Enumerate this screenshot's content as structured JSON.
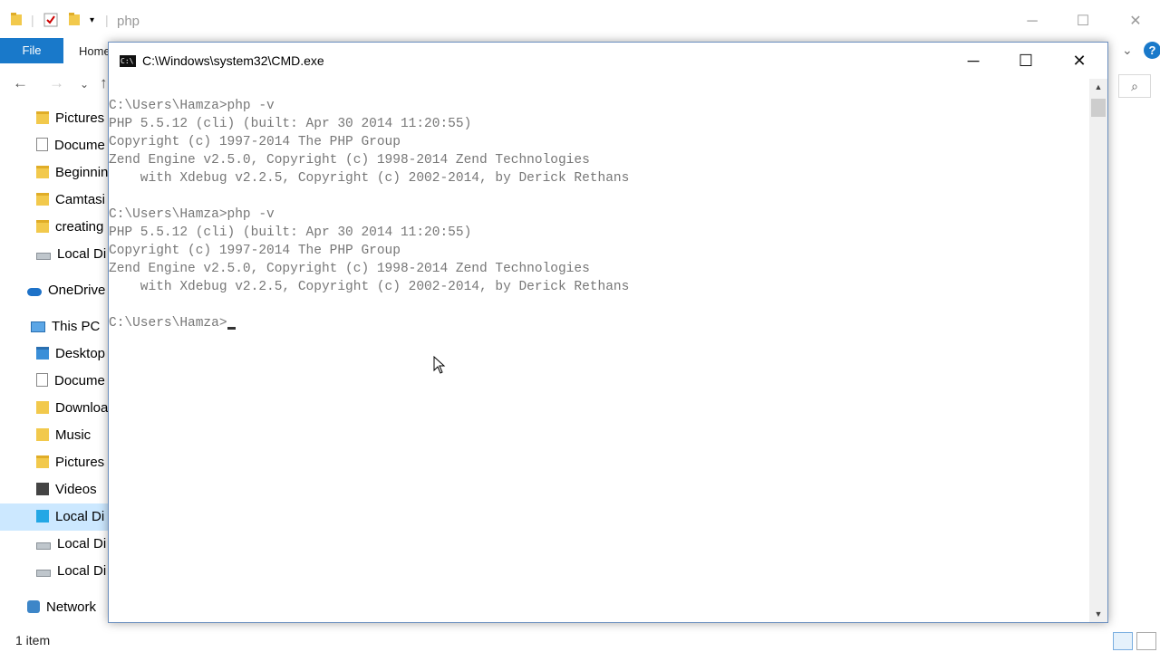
{
  "explorer": {
    "title": "php",
    "ribbon": {
      "file_label": "File",
      "home_label": "Home"
    },
    "nav_items": [
      {
        "label": "Pictures",
        "icon": "folder-icon"
      },
      {
        "label": "Docume",
        "icon": "document-icon"
      },
      {
        "label": "Beginnin",
        "icon": "folder-icon"
      },
      {
        "label": "Camtasi",
        "icon": "folder-icon"
      },
      {
        "label": "creating",
        "icon": "folder-icon"
      },
      {
        "label": "Local Di",
        "icon": "drive-icon"
      },
      {
        "label": "OneDrive",
        "icon": "onedrive-icon"
      },
      {
        "label": "This PC",
        "icon": "this-pc-icon"
      },
      {
        "label": "Desktop",
        "icon": "folder-icon"
      },
      {
        "label": "Docume",
        "icon": "document-icon"
      },
      {
        "label": "Downloa",
        "icon": "downloads-icon"
      },
      {
        "label": "Music",
        "icon": "music-icon"
      },
      {
        "label": "Pictures",
        "icon": "folder-icon"
      },
      {
        "label": "Videos",
        "icon": "video-icon"
      },
      {
        "label": "Local Di",
        "icon": "windows-drive-icon"
      },
      {
        "label": "Local Di",
        "icon": "drive-icon"
      },
      {
        "label": "Local Di",
        "icon": "drive-icon"
      },
      {
        "label": "Network",
        "icon": "network-icon"
      }
    ],
    "status": "1 item"
  },
  "cmd": {
    "title": "C:\\Windows\\system32\\CMD.exe",
    "icon_text": "C:\\",
    "lines": [
      "C:\\Users\\Hamza>php -v",
      "PHP 5.5.12 (cli) (built: Apr 30 2014 11:20:55)",
      "Copyright (c) 1997-2014 The PHP Group",
      "Zend Engine v2.5.0, Copyright (c) 1998-2014 Zend Technologies",
      "    with Xdebug v2.2.5, Copyright (c) 2002-2014, by Derick Rethans",
      "",
      "C:\\Users\\Hamza>php -v",
      "PHP 5.5.12 (cli) (built: Apr 30 2014 11:20:55)",
      "Copyright (c) 1997-2014 The PHP Group",
      "Zend Engine v2.5.0, Copyright (c) 1998-2014 Zend Technologies",
      "    with Xdebug v2.2.5, Copyright (c) 2002-2014, by Derick Rethans",
      ""
    ],
    "prompt": "C:\\Users\\Hamza>"
  },
  "colors": {
    "accent": "#1979ca",
    "console_text": "#777777",
    "console_bg": "#ffffff",
    "selected_nav": "#cce8ff"
  }
}
